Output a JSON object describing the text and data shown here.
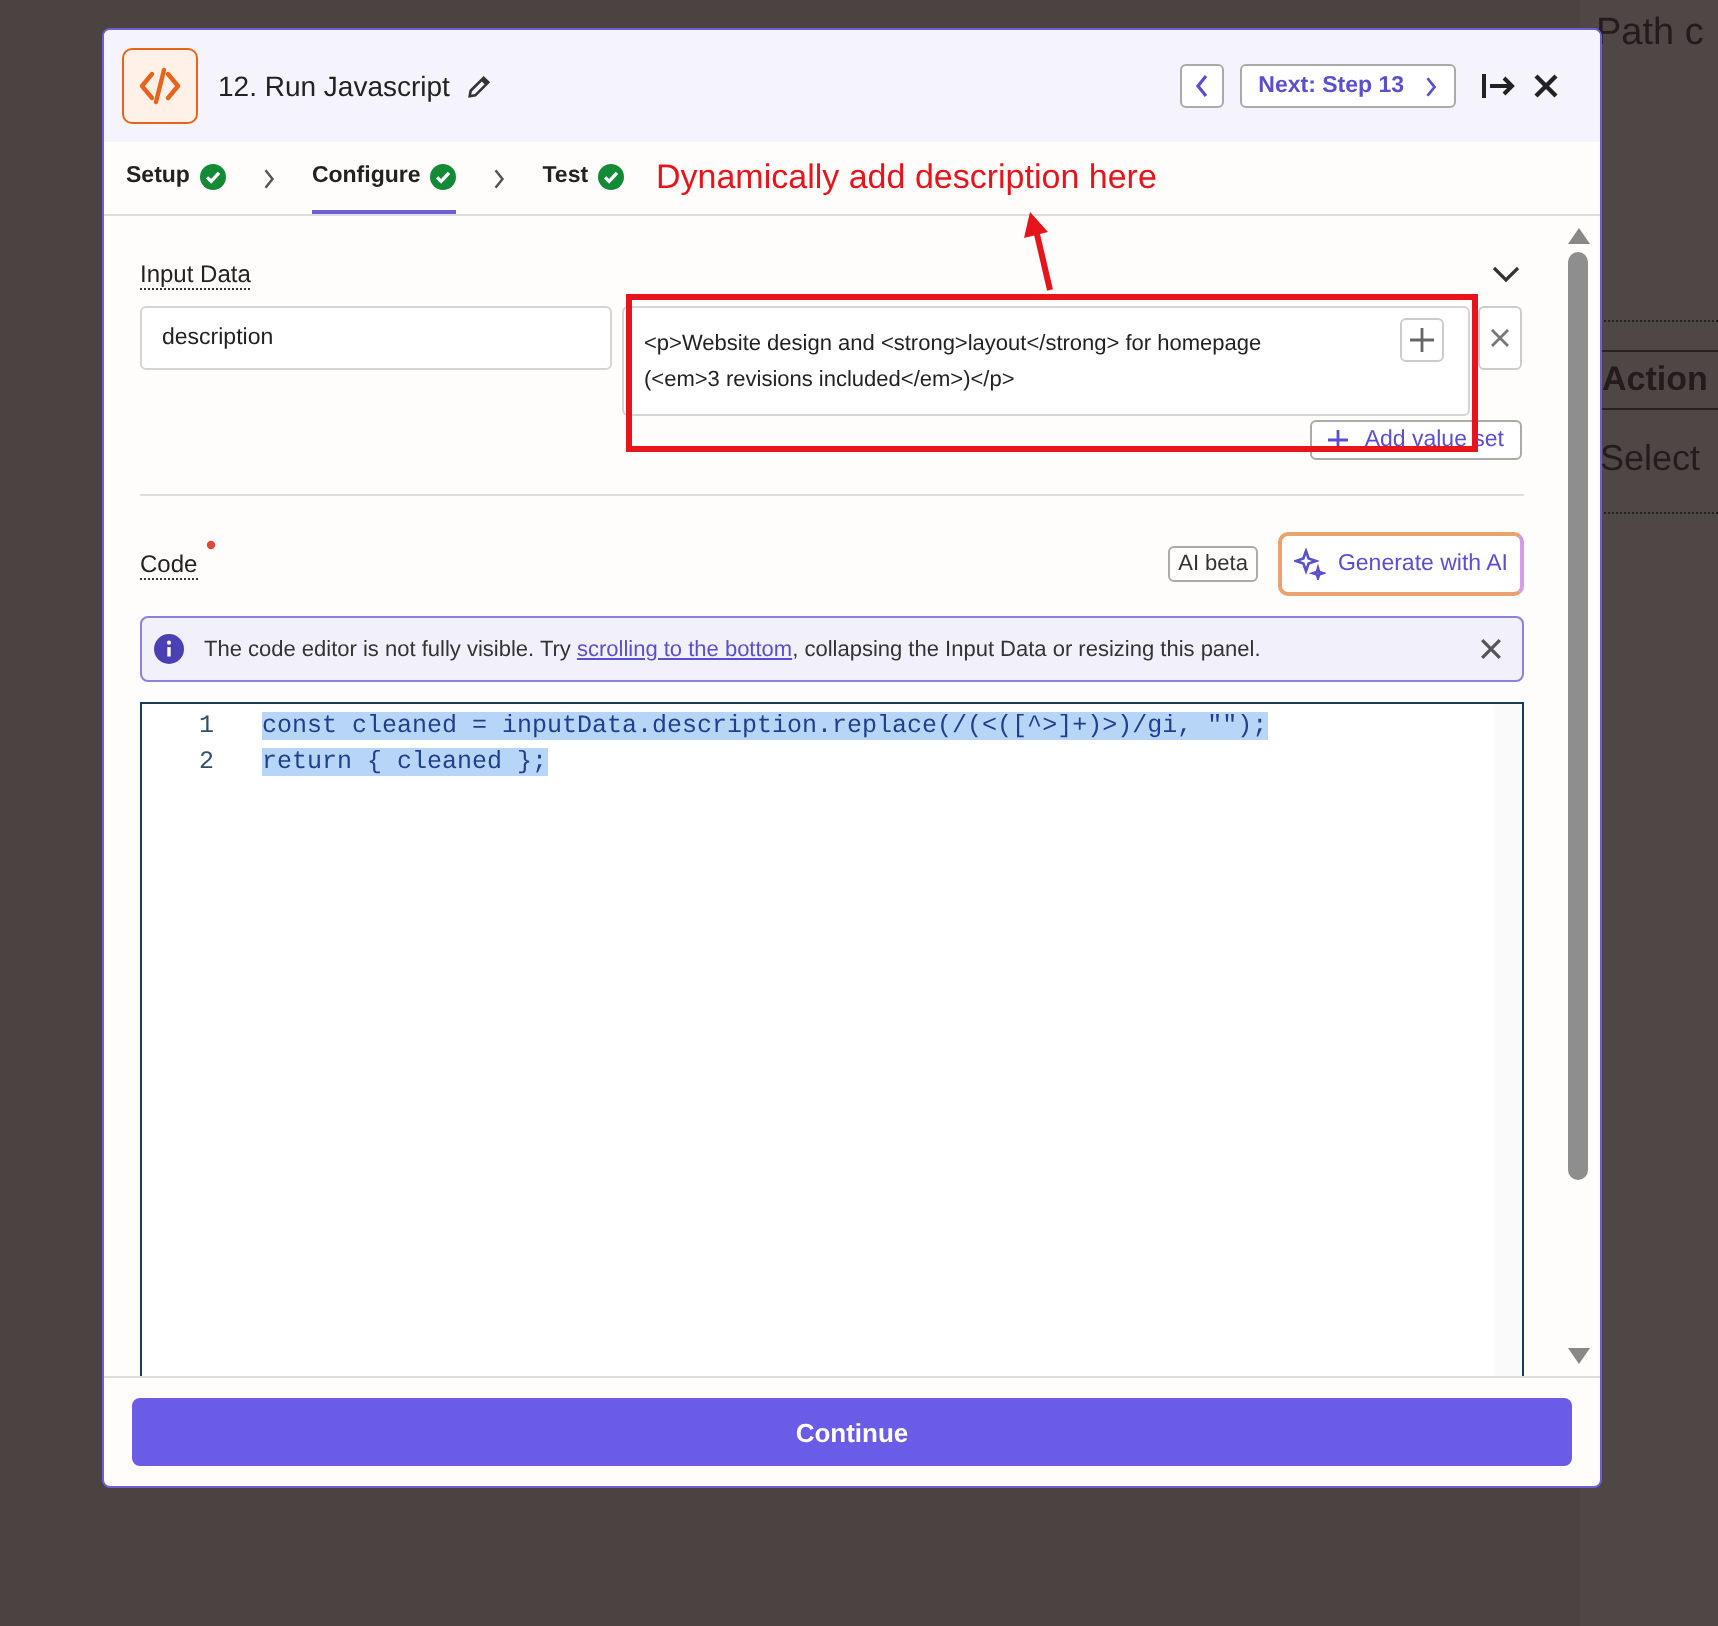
{
  "background": {
    "heading": "Path c",
    "action_button": "Action",
    "hint": "Select"
  },
  "window": {
    "title": "12. Run Javascript",
    "next_button": "Next: Step 13"
  },
  "tabs": [
    {
      "label": "Setup",
      "completed": true,
      "selected": false
    },
    {
      "label": "Configure",
      "completed": true,
      "selected": true
    },
    {
      "label": "Test",
      "completed": true,
      "selected": false
    }
  ],
  "annotation": {
    "text": "Dynamically add description here"
  },
  "input_data": {
    "label": "Input Data",
    "expanded": true,
    "rows": [
      {
        "key": "description",
        "value_lines": [
          "<p>Website design and <strong>layout</strong> for homepage",
          "(<em>3 revisions included</em>)</p>"
        ]
      }
    ],
    "add_button": "Add value set"
  },
  "code": {
    "label": "Code",
    "required": true,
    "ai_badge": "AI beta",
    "generate_button": "Generate with AI",
    "notice": {
      "before": "The code editor is not fully visible. Try ",
      "link": "scrolling to the bottom",
      "after": ", collapsing the Input Data or resizing this panel."
    },
    "lines": [
      {
        "number": "1",
        "text": "const cleaned = inputData.description.replace(/(<([^>]+)>)/gi, \"\");",
        "selected": true
      },
      {
        "number": "2",
        "text": "return { cleaned };",
        "selected": true
      }
    ]
  },
  "footer": {
    "button": "Continue"
  }
}
